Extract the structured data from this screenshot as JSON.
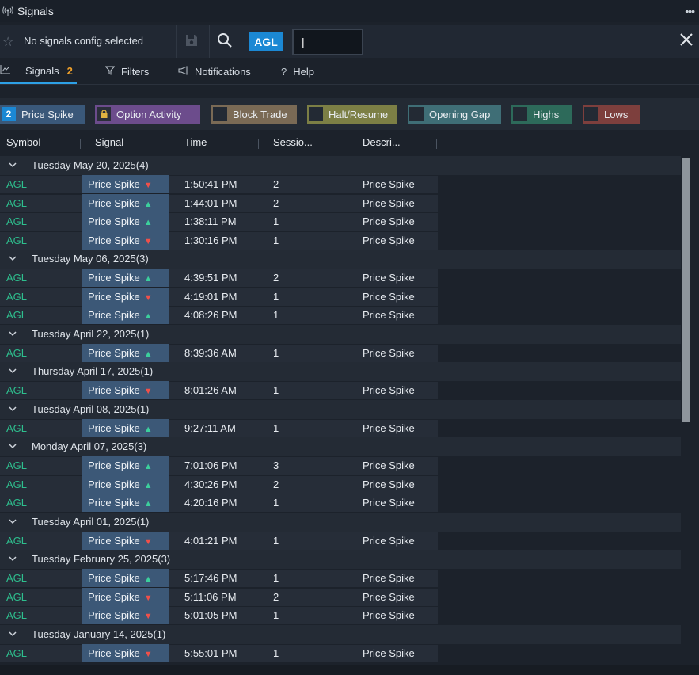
{
  "window": {
    "title": "Signals",
    "menu": "•••"
  },
  "config": {
    "label": "No signals config selected",
    "symbol": "AGL",
    "input_value": "|"
  },
  "tabs": [
    {
      "label": "Signals",
      "badge": "2"
    },
    {
      "label": "Filters"
    },
    {
      "label": "Notifications"
    },
    {
      "label": "Help"
    }
  ],
  "chips": [
    {
      "label": "Price Spike",
      "box": "2",
      "color": "#3a5879",
      "box_color": "#1b88d4"
    },
    {
      "label": "Option Activity",
      "box": "🔒",
      "color": "#6c4c8c",
      "box_color": "#2b2f3a"
    },
    {
      "label": "Block Trade",
      "box": "",
      "color": "#7a6a55",
      "box_color": "#232a34"
    },
    {
      "label": "Halt/Resume",
      "box": "",
      "color": "#7c7f45",
      "box_color": "#232a34"
    },
    {
      "label": "Opening Gap",
      "box": "",
      "color": "#3f6e76",
      "box_color": "#232a34"
    },
    {
      "label": "Highs",
      "box": "",
      "color": "#2d6a5a",
      "box_color": "#232a34"
    },
    {
      "label": "Lows",
      "box": "",
      "color": "#7d3f3d",
      "box_color": "#232a34"
    }
  ],
  "columns": [
    "Symbol",
    "Signal",
    "Time",
    "Sessio...",
    "Descri..."
  ],
  "groups": [
    {
      "label": "Tuesday May 20, 2025",
      "count": "(4)",
      "rows": [
        {
          "symbol": "AGL",
          "signal": "Price Spike",
          "dir": "down",
          "time": "1:50:41 PM",
          "session": "2",
          "desc": "Price Spike"
        },
        {
          "symbol": "AGL",
          "signal": "Price Spike",
          "dir": "up",
          "time": "1:44:01 PM",
          "session": "2",
          "desc": "Price Spike"
        },
        {
          "symbol": "AGL",
          "signal": "Price Spike",
          "dir": "up",
          "time": "1:38:11 PM",
          "session": "1",
          "desc": "Price Spike"
        },
        {
          "symbol": "AGL",
          "signal": "Price Spike",
          "dir": "down",
          "time": "1:30:16 PM",
          "session": "1",
          "desc": "Price Spike"
        }
      ]
    },
    {
      "label": "Tuesday May 06, 2025",
      "count": "(3)",
      "rows": [
        {
          "symbol": "AGL",
          "signal": "Price Spike",
          "dir": "up",
          "time": "4:39:51 PM",
          "session": "2",
          "desc": "Price Spike"
        },
        {
          "symbol": "AGL",
          "signal": "Price Spike",
          "dir": "down",
          "time": "4:19:01 PM",
          "session": "1",
          "desc": "Price Spike"
        },
        {
          "symbol": "AGL",
          "signal": "Price Spike",
          "dir": "up",
          "time": "4:08:26 PM",
          "session": "1",
          "desc": "Price Spike"
        }
      ]
    },
    {
      "label": "Tuesday April 22, 2025",
      "count": "(1)",
      "rows": [
        {
          "symbol": "AGL",
          "signal": "Price Spike",
          "dir": "up",
          "time": "8:39:36 AM",
          "session": "1",
          "desc": "Price Spike"
        }
      ]
    },
    {
      "label": "Thursday April 17, 2025",
      "count": "(1)",
      "rows": [
        {
          "symbol": "AGL",
          "signal": "Price Spike",
          "dir": "down",
          "time": "8:01:26 AM",
          "session": "1",
          "desc": "Price Spike"
        }
      ]
    },
    {
      "label": "Tuesday April 08, 2025",
      "count": "(1)",
      "rows": [
        {
          "symbol": "AGL",
          "signal": "Price Spike",
          "dir": "up",
          "time": "9:27:11 AM",
          "session": "1",
          "desc": "Price Spike"
        }
      ]
    },
    {
      "label": "Monday April 07, 2025",
      "count": "(3)",
      "rows": [
        {
          "symbol": "AGL",
          "signal": "Price Spike",
          "dir": "up",
          "time": "7:01:06 PM",
          "session": "3",
          "desc": "Price Spike"
        },
        {
          "symbol": "AGL",
          "signal": "Price Spike",
          "dir": "up",
          "time": "4:30:26 PM",
          "session": "2",
          "desc": "Price Spike"
        },
        {
          "symbol": "AGL",
          "signal": "Price Spike",
          "dir": "up",
          "time": "4:20:16 PM",
          "session": "1",
          "desc": "Price Spike"
        }
      ]
    },
    {
      "label": "Tuesday April 01, 2025",
      "count": "(1)",
      "rows": [
        {
          "symbol": "AGL",
          "signal": "Price Spike",
          "dir": "down",
          "time": "4:01:21 PM",
          "session": "1",
          "desc": "Price Spike"
        }
      ]
    },
    {
      "label": "Tuesday February 25, 2025",
      "count": "(3)",
      "rows": [
        {
          "symbol": "AGL",
          "signal": "Price Spike",
          "dir": "up",
          "time": "5:17:46 PM",
          "session": "1",
          "desc": "Price Spike"
        },
        {
          "symbol": "AGL",
          "signal": "Price Spike",
          "dir": "down",
          "time": "5:11:06 PM",
          "session": "2",
          "desc": "Price Spike"
        },
        {
          "symbol": "AGL",
          "signal": "Price Spike",
          "dir": "down",
          "time": "5:01:05 PM",
          "session": "1",
          "desc": "Price Spike"
        }
      ]
    },
    {
      "label": "Tuesday January 14, 2025",
      "count": "(1)",
      "rows": [
        {
          "symbol": "AGL",
          "signal": "Price Spike",
          "dir": "down",
          "time": "5:55:01 PM",
          "session": "1",
          "desc": "Price Spike"
        }
      ]
    }
  ],
  "colors": {
    "symbol_green": "#2ebf8e",
    "accent_blue": "#1b88d4",
    "badge_orange": "#f0a12a",
    "up": "#3ccf9c",
    "down": "#f0504a"
  }
}
